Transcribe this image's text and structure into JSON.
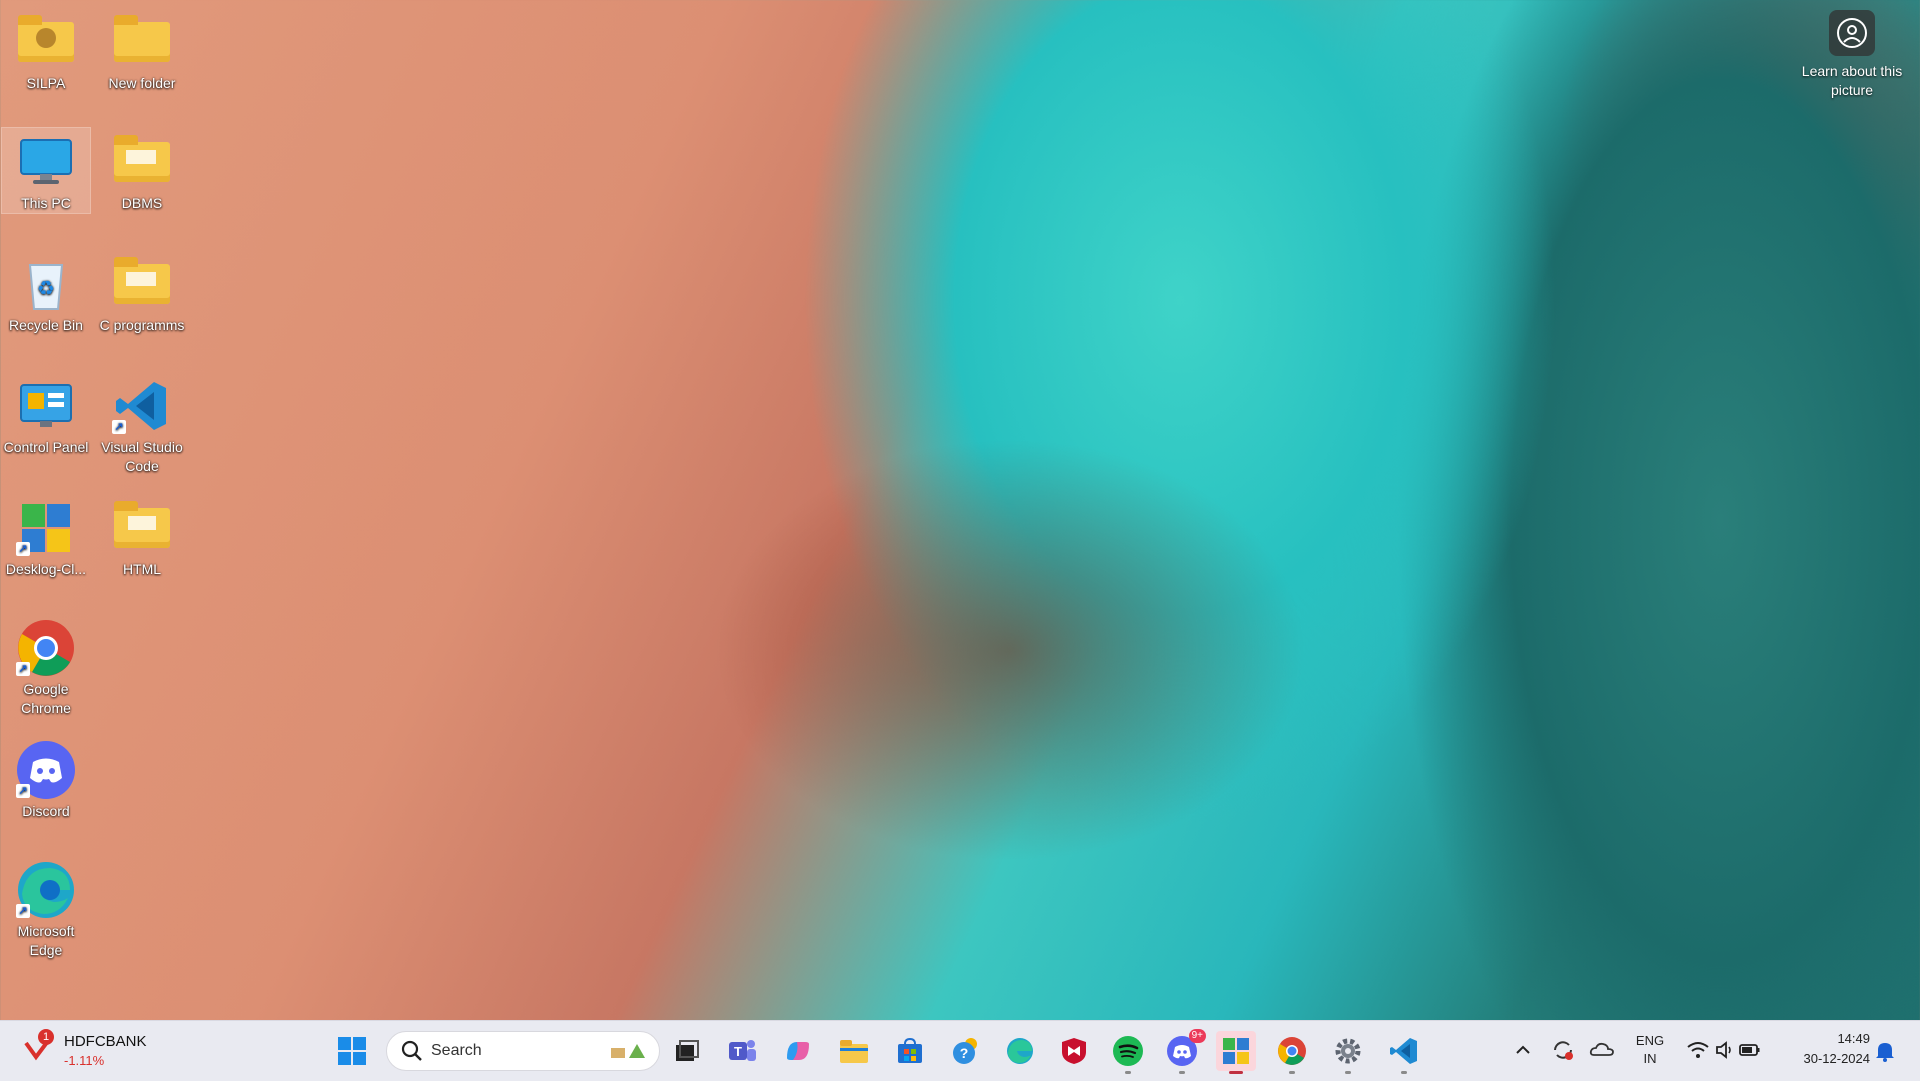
{
  "desktop": {
    "icons": [
      {
        "label": "SILPA"
      },
      {
        "label": "New folder"
      },
      {
        "label": "This PC"
      },
      {
        "label": "DBMS"
      },
      {
        "label": "Recycle Bin"
      },
      {
        "label": "C programms"
      },
      {
        "label": "Control Panel"
      },
      {
        "label": "Visual Studio Code"
      },
      {
        "label": "Desklog-Cl..."
      },
      {
        "label": "HTML"
      },
      {
        "label": "Google Chrome"
      },
      {
        "label": "Discord"
      },
      {
        "label": "Microsoft Edge"
      }
    ],
    "learn_picture": "Learn about this picture"
  },
  "taskbar": {
    "stock": {
      "name": "HDFCBANK",
      "change": "-1.11%",
      "badge": "1"
    },
    "search_placeholder": "Search",
    "discord_badge": "9+",
    "language": {
      "line1": "ENG",
      "line2": "IN"
    },
    "time": "14:49",
    "date": "30-12-2024"
  }
}
